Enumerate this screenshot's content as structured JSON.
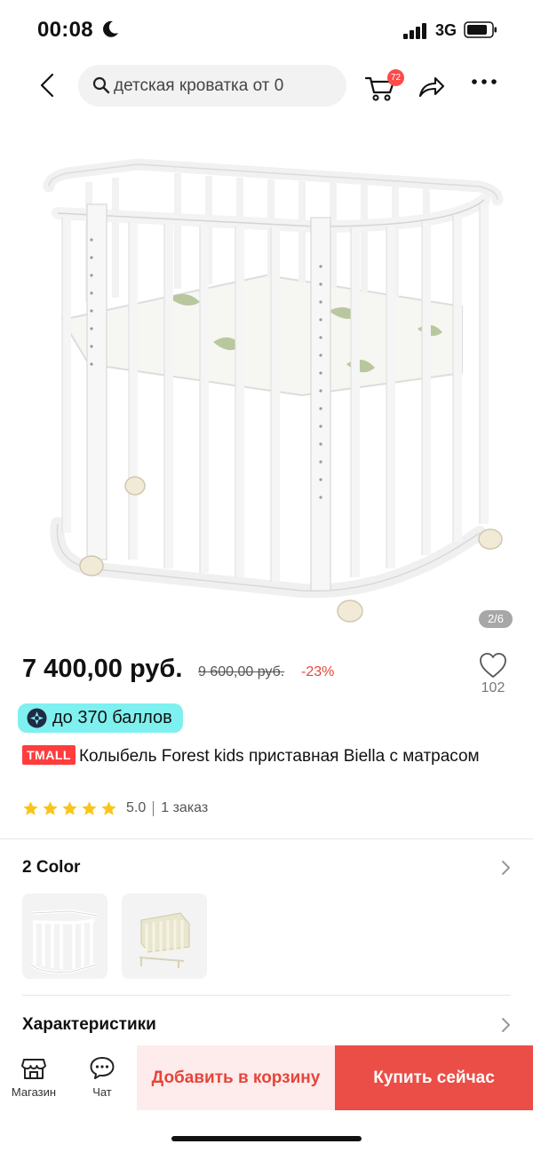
{
  "status_bar": {
    "time": "00:08",
    "network": "3G"
  },
  "nav": {
    "search_text": "детская кроватка от 0",
    "cart_count": "72"
  },
  "gallery": {
    "page_indicator": "2/6"
  },
  "product": {
    "price": "7 400,00 руб.",
    "old_price": "9 600,00 руб.",
    "discount": "-23%",
    "favorites_count": "102",
    "points": "до 370 баллов",
    "store_badge": "TMALL",
    "title": "Колыбель Forest kids приставная Biella с матрасом",
    "rating": "5.0",
    "rating_stars": 5,
    "orders": "1 заказ"
  },
  "colors": {
    "title": "2 Color"
  },
  "specs": {
    "title": "Характеристики"
  },
  "bottom_bar": {
    "store_label": "Магазин",
    "chat_label": "Чат",
    "add_to_cart": "Добавить в корзину",
    "buy_now": "Купить сейчас"
  },
  "theme": {
    "accent": "#ea4e46",
    "accent_light": "#fdeceb",
    "points_bg": "#7ef0ef",
    "badge": "#ff4a4a"
  }
}
